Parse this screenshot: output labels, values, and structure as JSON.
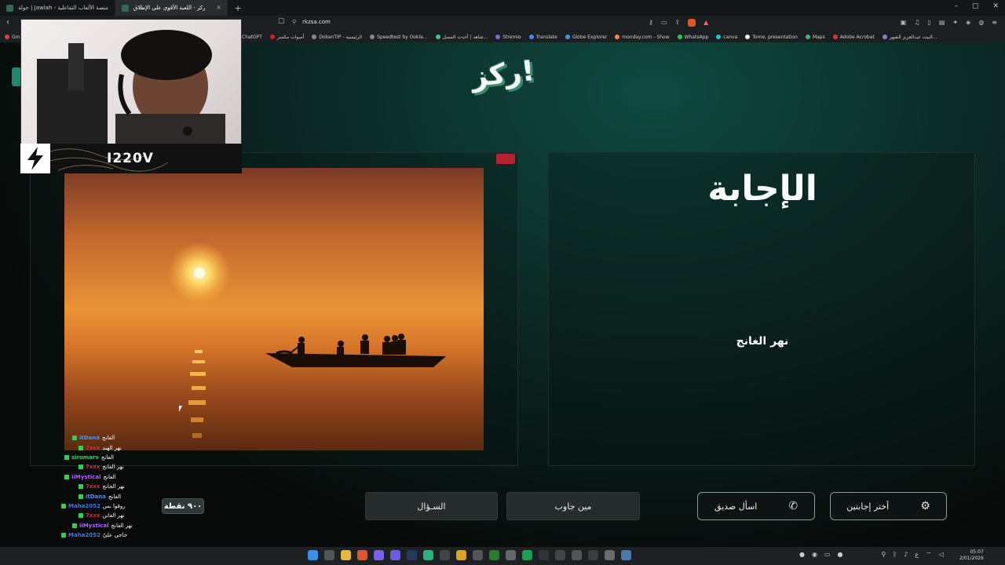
{
  "browser": {
    "tabs": [
      {
        "label": "جولة | Jawlah - منصة الألعاب التفاعلية",
        "active": false
      },
      {
        "label": "ركز - اللعبة الأقوى على الإطلاق",
        "active": true
      }
    ],
    "new_tab": "+",
    "url": "rkzsa.com",
    "window_controls": [
      "–",
      "▢",
      "✕"
    ],
    "bookmarks": [
      "ChatGPT",
      "أصوات مكسر",
      "DokanTIP - الرئيسية",
      "Speedtest by Ookla...",
      "شاهد | أحدث المسل...",
      "Stremio",
      "Translate",
      "Globe Explorer",
      "monday.com - Show",
      "WhatsApp",
      "canva",
      "Tome, presentation",
      "Maps",
      "Adobe Acrobat",
      "البيت عبدالعزيز الشهر..."
    ],
    "bookmark_left": "Gmi"
  },
  "game": {
    "logo_text": "ركز!",
    "answer_title": "الإجابة",
    "answer_text": "نهر الغانج",
    "buttons": {
      "question": "السـؤال",
      "who_answered": "مين جاوب",
      "ask_friend": "اسأل صديق",
      "choose_answers": "أختر إجابتين"
    },
    "points": "٩٠٠ نقطة"
  },
  "stream": {
    "streamer_name": "I220V",
    "chat": [
      {
        "user": "itDana",
        "msg": "الغانج",
        "color": "#4a90ff"
      },
      {
        "user": "7xxx",
        "msg": "نهر الهند",
        "color": "#d0303a"
      },
      {
        "user": "siromarv",
        "msg": "الغانج",
        "color": "#35d05a"
      },
      {
        "user": "7xxx",
        "msg": "نهر الغانج",
        "color": "#d0303a"
      },
      {
        "user": "iiMystical",
        "msg": "الغانج",
        "color": "#b55cff"
      },
      {
        "user": "7xxx",
        "msg": "نهر الجانج",
        "color": "#d0303a"
      },
      {
        "user": "itDana",
        "msg": "الغانج",
        "color": "#4a90ff"
      },
      {
        "user": "Maha2052",
        "msg": "روقوا بس",
        "color": "#3f7ad8"
      },
      {
        "user": "7xxx",
        "msg": "نهر الغانن",
        "color": "#d0303a"
      },
      {
        "user": "iiMystical",
        "msg": "نهر الغانج",
        "color": "#b55cff"
      },
      {
        "user": "Maha2052",
        "msg": "حاجي عليّ",
        "color": "#3f7ad8"
      }
    ]
  },
  "taskbar": {
    "time": "05:07",
    "date": "2/01/2026"
  },
  "colors": {
    "accent": "#1d8a6f",
    "button_dark": "#262c2b",
    "chat_badge": "#2bd14f"
  }
}
